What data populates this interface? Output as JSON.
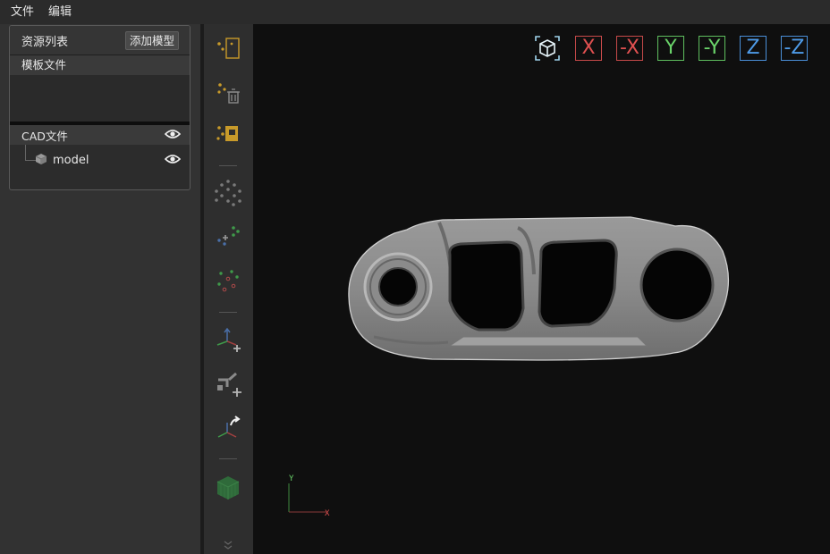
{
  "menu": [
    {
      "label": "文件"
    },
    {
      "label": "编辑"
    }
  ],
  "resources": {
    "title": "资源列表",
    "add_button": "添加模型",
    "template_section": "模板文件",
    "cad_section": "CAD文件",
    "tree": [
      {
        "label": "model",
        "visible": true
      }
    ]
  },
  "toolbar": {
    "icons": [
      "add-point-icon",
      "delete-point-icon",
      "copy-point-icon",
      "sample-points-icon",
      "add-points-icon",
      "edit-points-icon",
      "add-axis-icon",
      "add-pick-point-icon",
      "rotate-axis-icon",
      "model-display-icon",
      "more-icon"
    ]
  },
  "view_buttons": [
    {
      "label": "X",
      "axis": "x"
    },
    {
      "label": "-X",
      "axis": "x"
    },
    {
      "label": "Y",
      "axis": "y"
    },
    {
      "label": "-Y",
      "axis": "y"
    },
    {
      "label": "Z",
      "axis": "z"
    },
    {
      "label": "-Z",
      "axis": "z"
    }
  ],
  "axis_indicator": {
    "y_label": "Y",
    "x_label": "X"
  },
  "colors": {
    "x_axis": "#e05050",
    "y_axis": "#6ad46a",
    "z_axis": "#4e9be8",
    "accent_icon": "#c89a2a",
    "model": "#8e8e8e"
  }
}
